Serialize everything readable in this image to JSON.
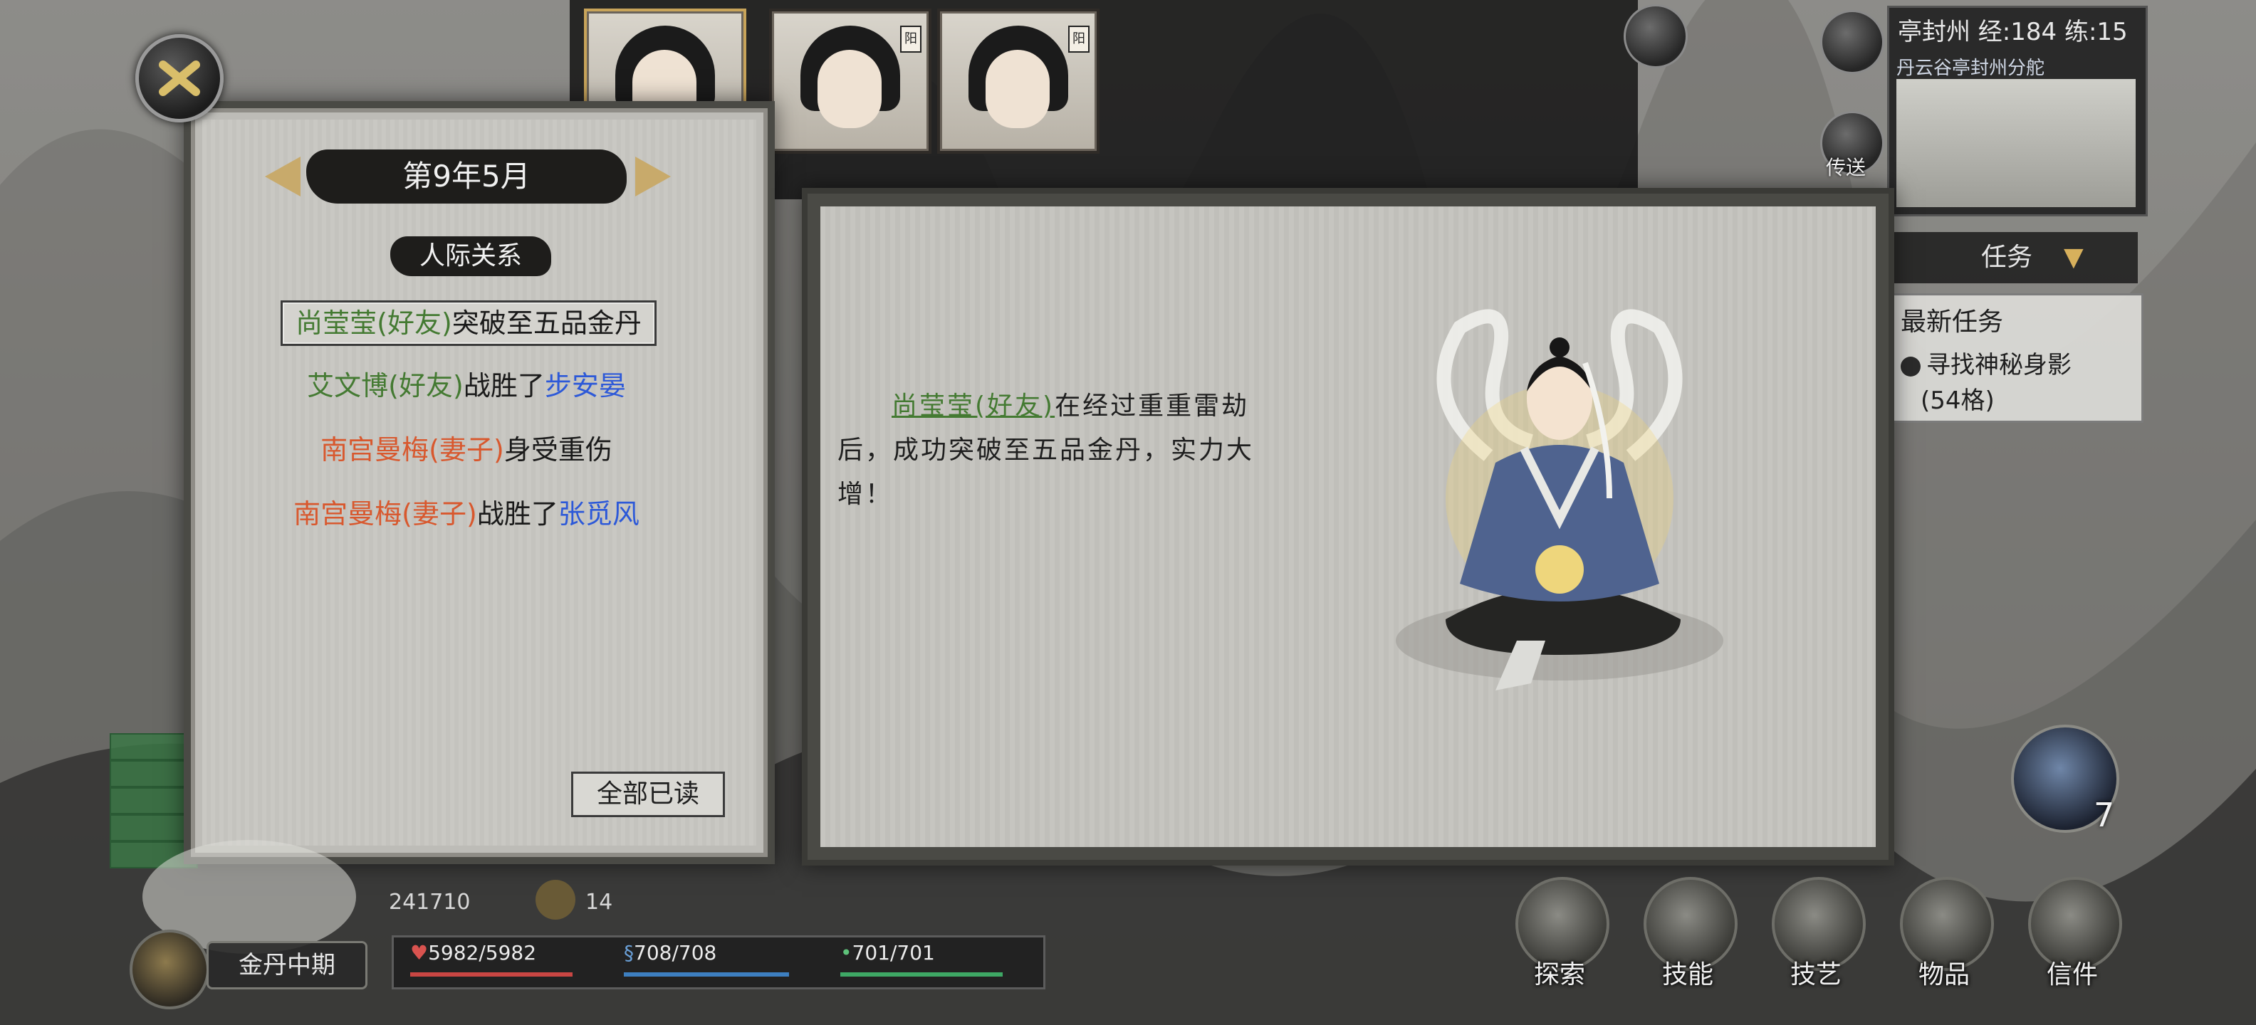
{
  "hud": {
    "status_header": "亭封州 经:184 练:15",
    "status_sub": "丹云谷亭封州分舵",
    "task_header_label": "任务",
    "task_box_title": "最新任务",
    "task_box_item": "寻找神秘身影",
    "task_box_distance": "(54格)",
    "realm": "金丹中期",
    "hp": "5982/5982",
    "mp": "708/708",
    "stamina": "701/701",
    "spirit_stones": "241710",
    "coins": "14",
    "yin_yang_count": "7",
    "right_mini_label": "传送"
  },
  "bottom_menu": [
    {
      "label": "探索"
    },
    {
      "label": "技能"
    },
    {
      "label": "技艺"
    },
    {
      "label": "物品"
    },
    {
      "label": "信件"
    }
  ],
  "left_panel": {
    "date": "第9年5月",
    "section": "人际关系",
    "events": [
      {
        "pre": "尚莹莹(好友)",
        "pre_color": "green",
        "mid": "突破至五品金丹",
        "post": "",
        "post_color": ""
      },
      {
        "pre": "艾文博(好友)",
        "pre_color": "green",
        "mid": "战胜了",
        "post": "步安晏",
        "post_color": "blue"
      },
      {
        "pre": "南宫曼梅(妻子)",
        "pre_color": "orange",
        "mid": "身受重伤",
        "post": "",
        "post_color": ""
      },
      {
        "pre": "南宫曼梅(妻子)",
        "pre_color": "orange",
        "mid": "战胜了",
        "post": "张觅风",
        "post_color": "blue"
      }
    ],
    "mark_all_read": "全部已读"
  },
  "detail_panel": {
    "name": "尚莹莹(好友)",
    "text": "在经过重重雷劫后，成功突破至五品金丹，实力大增！"
  },
  "colors": {
    "green": "#447a32",
    "orange": "#d8582e",
    "blue": "#2d59d8"
  }
}
